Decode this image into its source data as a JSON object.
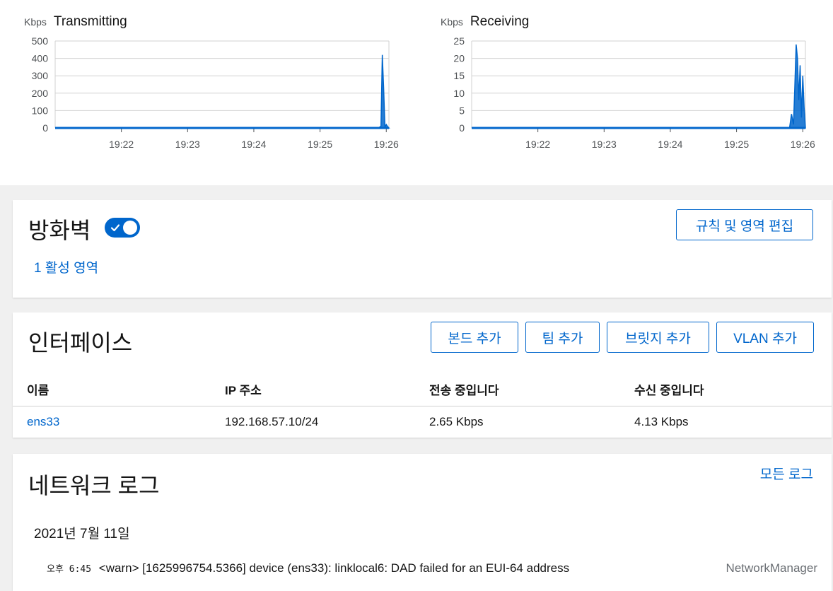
{
  "charts": {
    "transmitting": {
      "title": "Transmitting",
      "unit": "Kbps",
      "y_ticks": [
        "500",
        "400",
        "300",
        "200",
        "100",
        "0"
      ],
      "x_ticks": [
        "19:22",
        "19:23",
        "19:24",
        "19:25",
        "19:26"
      ]
    },
    "receiving": {
      "title": "Receiving",
      "unit": "Kbps",
      "y_ticks": [
        "25",
        "20",
        "15",
        "10",
        "5",
        "0"
      ],
      "x_ticks": [
        "19:22",
        "19:23",
        "19:24",
        "19:25",
        "19:26"
      ]
    },
    "line_color": "#0066cc"
  },
  "chart_data": [
    {
      "type": "area",
      "title": "Transmitting",
      "ylabel": "Kbps",
      "ylim": [
        0,
        500
      ],
      "x_ticks": [
        "19:22",
        "19:23",
        "19:24",
        "19:25",
        "19:26"
      ],
      "x": [
        0,
        4.88,
        4.92,
        4.94,
        4.96,
        4.98,
        5.0,
        5.02,
        5.04
      ],
      "series": [
        {
          "values": [
            0,
            0,
            10,
            420,
            230,
            5,
            20,
            8,
            0
          ]
        }
      ],
      "grid": true
    },
    {
      "type": "area",
      "title": "Receiving",
      "ylabel": "Kbps",
      "ylim": [
        0,
        25
      ],
      "x_ticks": [
        "19:22",
        "19:23",
        "19:24",
        "19:25",
        "19:26"
      ],
      "x": [
        0,
        4.8,
        4.83,
        4.86,
        4.88,
        4.9,
        4.92,
        4.94,
        4.96,
        4.98,
        5.0,
        5.02,
        5.04
      ],
      "series": [
        {
          "values": [
            0,
            0,
            4,
            1,
            12,
            24,
            20,
            8,
            18,
            3,
            15,
            6,
            0
          ]
        }
      ],
      "grid": true
    }
  ],
  "firewall": {
    "title": "방화벽",
    "toggle_on": true,
    "active_zones_link": "1 활성 영역",
    "edit_button": "규칙 및 영역 편집"
  },
  "interfaces": {
    "title": "인터페이스",
    "buttons": {
      "add_bond": "본드 추가",
      "add_team": "팀 추가",
      "add_bridge": "브릿지 추가",
      "add_vlan": "VLAN 추가"
    },
    "columns": [
      "이름",
      "IP 주소",
      "전송 중입니다",
      "수신 중입니다"
    ],
    "rows": [
      {
        "name": "ens33",
        "ip": "192.168.57.10/24",
        "sending": "2.65 Kbps",
        "receiving": "4.13 Kbps"
      }
    ]
  },
  "network_log": {
    "title": "네트워크 로그",
    "all_logs_link": "모든 로그",
    "date": "2021년 7월 11일",
    "entries": [
      {
        "time": "오후 6:45",
        "message": "<warn> [1625996754.5366] device (ens33): linklocal6: DAD failed for an EUI-64 address",
        "source": "NetworkManager"
      }
    ]
  }
}
